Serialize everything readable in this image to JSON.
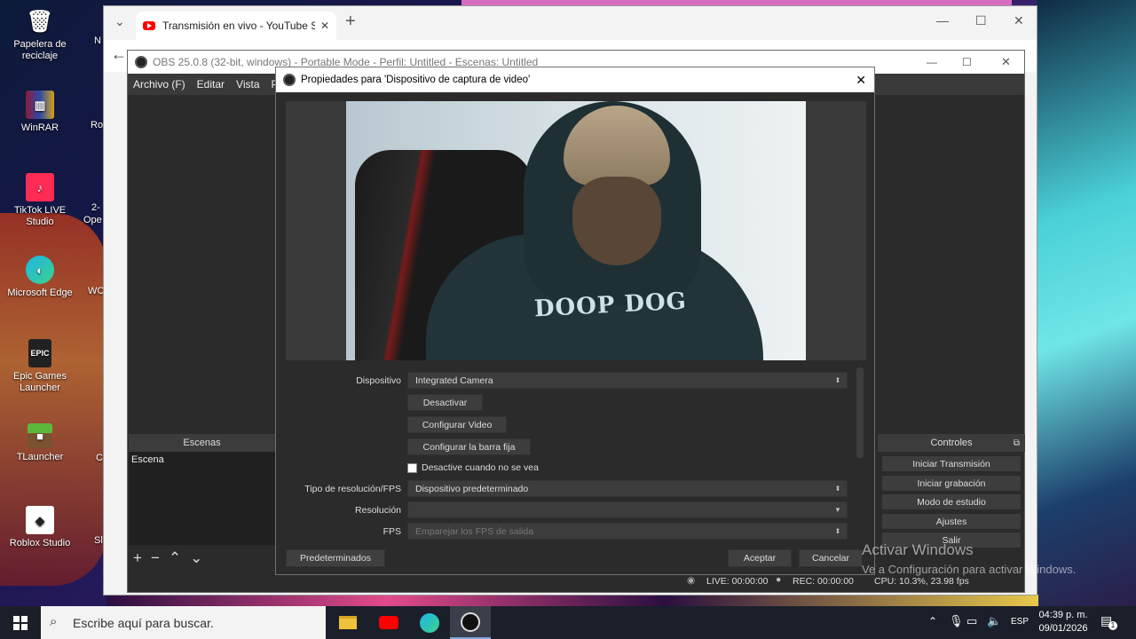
{
  "desktop": {
    "icons": [
      {
        "label": "Papelera de reciclaje",
        "glyph": "🗑"
      },
      {
        "label": "WinRAR",
        "glyph": "▥"
      },
      {
        "label": "TikTok LIVE Studio",
        "glyph": "♪"
      },
      {
        "label": "Microsoft Edge",
        "glyph": "◐"
      },
      {
        "label": "Epic Games Launcher",
        "glyph": "EPIC"
      },
      {
        "label": "TLauncher",
        "glyph": "■"
      },
      {
        "label": "Roblox Studio",
        "glyph": "◆"
      }
    ],
    "cutoff_labels": [
      "N",
      "Ro",
      "2-",
      "Ope",
      "WC",
      "C",
      "Sl"
    ]
  },
  "browser": {
    "tab_title": "Transmisión en vivo - YouTube Stu",
    "close": "✕",
    "new_tab": "+",
    "minimize": "—",
    "maximize": "☐",
    "win_close": "✕",
    "dropdown": "⌄",
    "back": "←"
  },
  "obs": {
    "title": "OBS 25.0.8 (32-bit, windows) - Portable Mode - Perfil: Untitled - Escenas: Untitled",
    "menu": [
      "Archivo (F)",
      "Editar",
      "Vista",
      "P"
    ],
    "scenes_header": "Escenas",
    "scenes": [
      "Escena"
    ],
    "controls_header": "Controles",
    "controls": [
      "Iniciar Transmisión",
      "Iniciar grabación",
      "Modo de estudio",
      "Ajustes",
      "Salir"
    ],
    "status": {
      "live": "LIVE: 00:00:00",
      "rec": "REC: 00:00:00",
      "cpu": "CPU: 10.3%, 23.98 fps"
    },
    "win_min": "—",
    "win_max": "☐",
    "win_close": "✕"
  },
  "dialog": {
    "title": "Propiedades para 'Dispositivo de captura de video'",
    "close": "✕",
    "fields": {
      "dispositivo_label": "Dispositivo",
      "dispositivo_value": "Integrated Camera",
      "desactivar_btn": "Desactivar",
      "config_video_btn": "Configurar Video",
      "config_barra_btn": "Configurar la barra fija",
      "desactive_checkbox": "Desactive cuando no se vea",
      "tipo_label": "Tipo de resolución/FPS",
      "tipo_value": "Dispositivo predeterminado",
      "resolucion_label": "Resolución",
      "resolucion_value": "",
      "fps_label": "FPS",
      "fps_value": "Emparejar los FPS de salida"
    },
    "buttons": {
      "defaults": "Predeterminados",
      "accept": "Aceptar",
      "cancel": "Cancelar"
    },
    "camera_text": "DOOP DOG"
  },
  "taskbar": {
    "search_placeholder": "Escribe aquí para buscar.",
    "lang": "ESP",
    "time": "04:39 p. m.",
    "date": "09/01/2026",
    "notif_count": "1"
  },
  "watermark": {
    "line1": "Activar Windows",
    "line2": "Ve a Configuración para activar Windows."
  }
}
